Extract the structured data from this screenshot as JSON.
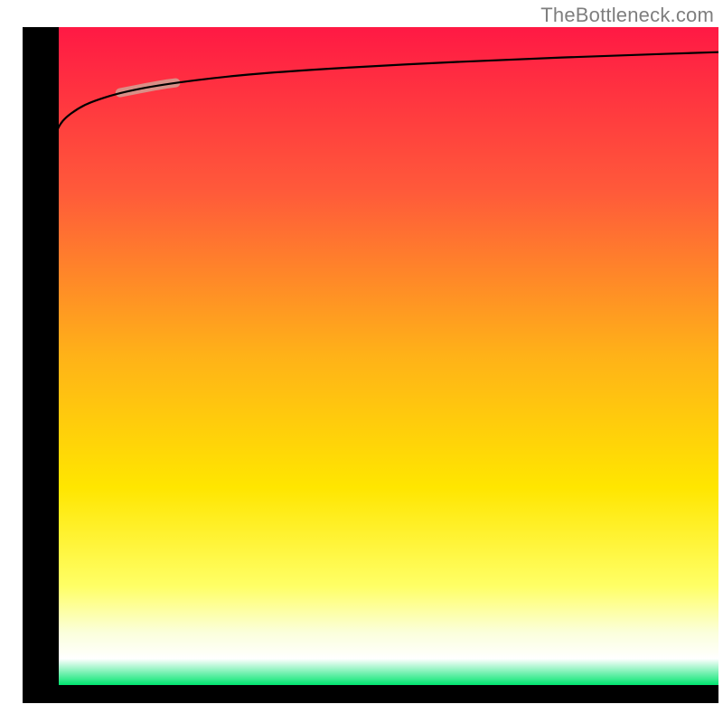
{
  "watermark": "TheBottleneck.com",
  "chart_data": {
    "type": "line",
    "title": "",
    "xlabel": "",
    "ylabel": "",
    "xlim": [
      0,
      100
    ],
    "ylim": [
      0,
      100
    ],
    "grid": false,
    "legend": false,
    "background_gradient_stops": [
      {
        "offset": 0.0,
        "color": "#ff1944"
      },
      {
        "offset": 0.25,
        "color": "#ff5a3a"
      },
      {
        "offset": 0.5,
        "color": "#ffb218"
      },
      {
        "offset": 0.7,
        "color": "#ffe600"
      },
      {
        "offset": 0.85,
        "color": "#ffff66"
      },
      {
        "offset": 0.92,
        "color": "#fbffdb"
      },
      {
        "offset": 0.96,
        "color": "#ffffff"
      },
      {
        "offset": 1.0,
        "color": "#00e56f"
      }
    ],
    "series": [
      {
        "name": "curve",
        "x": [
          2.5,
          2.6,
          3.0,
          3.5,
          4.0,
          5.0,
          6.0,
          8.0,
          10,
          14,
          20,
          30,
          40,
          55,
          70,
          85,
          100
        ],
        "y": [
          2.0,
          40,
          70,
          78,
          82,
          85,
          86.5,
          88,
          89,
          90.3,
          91.5,
          92.8,
          93.6,
          94.5,
          95.2,
          95.8,
          96.3
        ]
      }
    ],
    "highlight_segment": {
      "series": "curve",
      "x_range": [
        14,
        22
      ],
      "color": "#d98f87",
      "width": 10
    },
    "axes": {
      "left": {
        "x": 2.5,
        "from_y": 0,
        "to_y": 100,
        "width": 40,
        "color": "#000000"
      },
      "bottom": {
        "y": 0,
        "from_x": 0,
        "to_x": 100,
        "width": 20,
        "color": "#000000"
      }
    }
  }
}
